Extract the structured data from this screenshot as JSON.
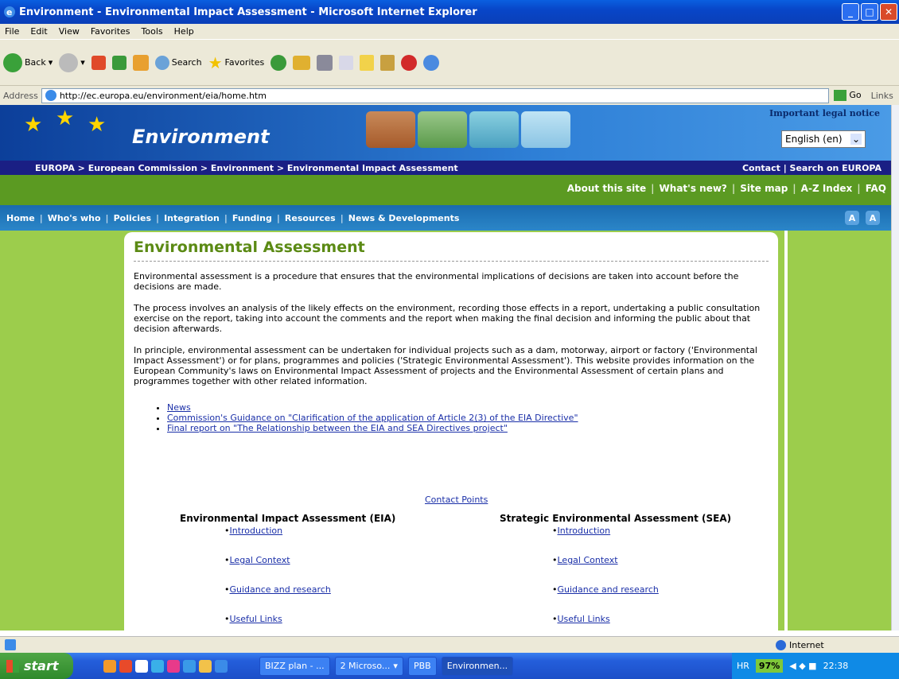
{
  "window": {
    "title": "Environment - Environmental Impact Assessment - Microsoft Internet Explorer"
  },
  "menu": [
    "File",
    "Edit",
    "View",
    "Favorites",
    "Tools",
    "Help"
  ],
  "toolbar": {
    "back": "Back",
    "search": "Search",
    "favorites": "Favorites"
  },
  "address": {
    "label": "Address",
    "url": "http://ec.europa.eu/environment/eia/home.htm",
    "go": "Go",
    "links": "Links"
  },
  "banner": {
    "title": "Environment",
    "legal": "Important legal notice",
    "language": "English (en)"
  },
  "breadcrumb": {
    "path": "EUROPA > European Commission > Environment > Environmental Impact Assessment",
    "right": "Contact | Search on EUROPA"
  },
  "sitelinks": [
    "About this site",
    "What's new?",
    "Site map",
    "A-Z Index",
    "FAQ"
  ],
  "nav": [
    "Home",
    "Who's who",
    "Policies",
    "Integration",
    "Funding",
    "Resources",
    "News & Developments"
  ],
  "page": {
    "heading": "Environmental Assessment",
    "p1": "Environmental assessment is a procedure that ensures that the environmental implications of decisions are taken into account before the decisions are made.",
    "p2": "The process involves an analysis of the likely effects on the environment, recording those effects in a report, undertaking a public consultation exercise on the report, taking into account the comments and the report when making the final decision and informing the public about that decision afterwards.",
    "p3": "In principle, environmental assessment can be undertaken for individual projects such as a dam, motorway, airport or factory ('Environmental Impact Assessment') or for plans, programmes and policies ('Strategic Environmental Assessment'). This website provides information on the European Community's laws on Environmental Impact Assessment of projects and the Environmental Assessment of certain plans and programmes together with other related information.",
    "links": [
      "News",
      "Commission's Guidance on \"Clarification of the application of Article 2(3) of the EIA Directive\"",
      "Final report on \"The Relationship between the EIA and SEA Directives project\""
    ],
    "contact": "Contact Points",
    "eia": {
      "heading": "Environmental Impact Assessment (EIA)",
      "items": [
        "Introduction",
        "Legal Context",
        "Guidance and research",
        "Useful Links"
      ]
    },
    "sea": {
      "heading": "Strategic Environmental Assessment (SEA)",
      "items": [
        "Introduction",
        "Legal Context",
        "Guidance and research",
        "Useful Links"
      ]
    }
  },
  "status": {
    "zone": "Internet"
  },
  "taskbar": {
    "start": "start",
    "tasks": [
      "BIZZ plan - ...",
      "2 Microso...",
      "PBB",
      "Environmen..."
    ],
    "lang": "HR",
    "battery": "97%",
    "time": "22:38"
  }
}
